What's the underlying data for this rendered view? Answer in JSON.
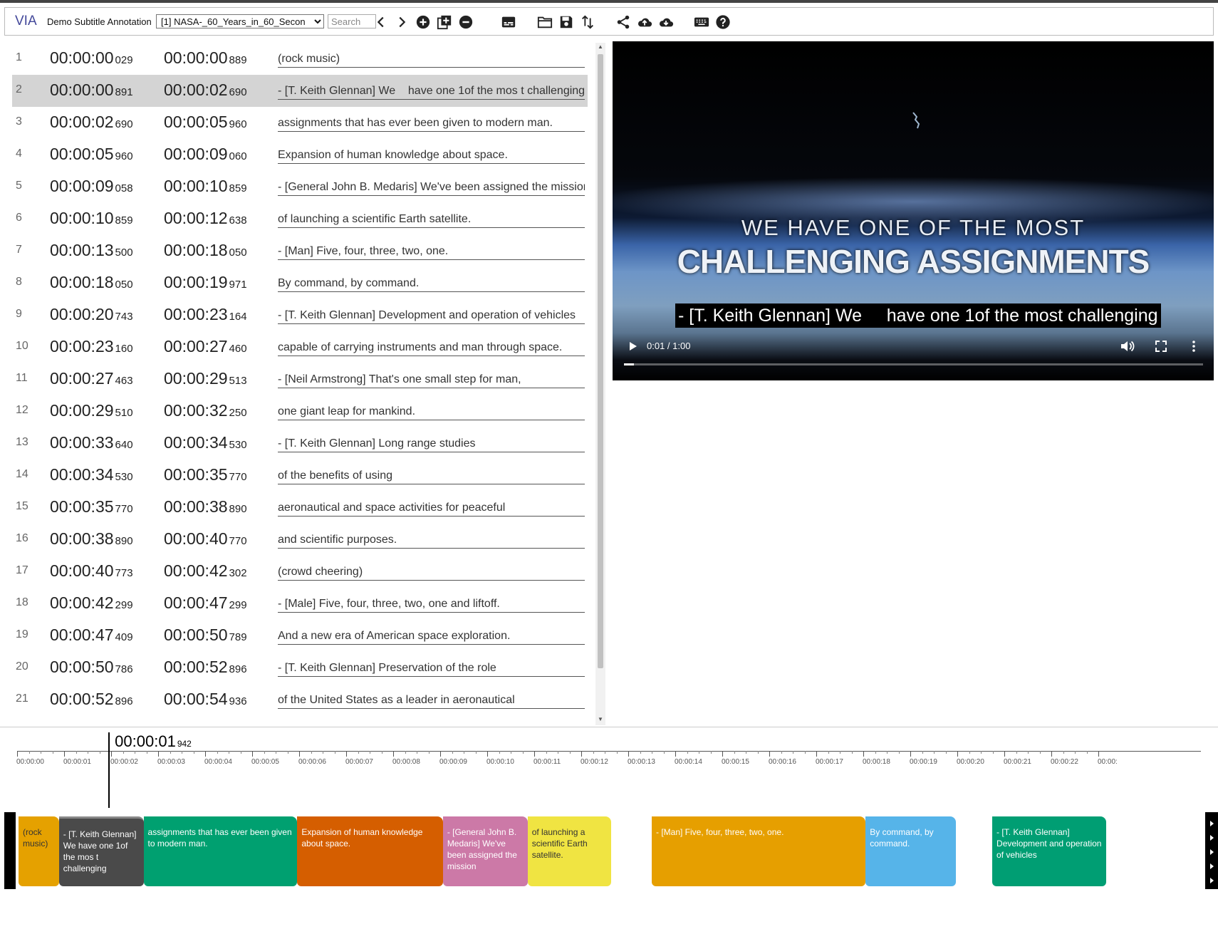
{
  "app": {
    "logo": "VIA",
    "project_name": "Demo Subtitle Annotation",
    "file_selected": "[1] NASA-_60_Years_in_60_Secon",
    "search_placeholder": "Search"
  },
  "subtitles": [
    {
      "idx": "1",
      "start": "00:00:00",
      "start_ms": "029",
      "end": "00:00:00",
      "end_ms": "889",
      "text": "(rock music)"
    },
    {
      "idx": "2",
      "start": "00:00:00",
      "start_ms": "891",
      "end": "00:00:02",
      "end_ms": "690",
      "text": "- [T. Keith Glennan] We    have one 1of the mos t challenging"
    },
    {
      "idx": "3",
      "start": "00:00:02",
      "start_ms": "690",
      "end": "00:00:05",
      "end_ms": "960",
      "text": "assignments that has ever been given to modern man."
    },
    {
      "idx": "4",
      "start": "00:00:05",
      "start_ms": "960",
      "end": "00:00:09",
      "end_ms": "060",
      "text": "Expansion of human knowledge about space."
    },
    {
      "idx": "5",
      "start": "00:00:09",
      "start_ms": "058",
      "end": "00:00:10",
      "end_ms": "859",
      "text": "- [General John B. Medaris] We've been assigned the mission"
    },
    {
      "idx": "6",
      "start": "00:00:10",
      "start_ms": "859",
      "end": "00:00:12",
      "end_ms": "638",
      "text": "of launching a scientific Earth satellite."
    },
    {
      "idx": "7",
      "start": "00:00:13",
      "start_ms": "500",
      "end": "00:00:18",
      "end_ms": "050",
      "text": "- [Man] Five, four, three, two, one."
    },
    {
      "idx": "8",
      "start": "00:00:18",
      "start_ms": "050",
      "end": "00:00:19",
      "end_ms": "971",
      "text": "By command, by command."
    },
    {
      "idx": "9",
      "start": "00:00:20",
      "start_ms": "743",
      "end": "00:00:23",
      "end_ms": "164",
      "text": "- [T. Keith Glennan] Development and operation of vehicles"
    },
    {
      "idx": "10",
      "start": "00:00:23",
      "start_ms": "160",
      "end": "00:00:27",
      "end_ms": "460",
      "text": "capable of carrying instruments and man through space."
    },
    {
      "idx": "11",
      "start": "00:00:27",
      "start_ms": "463",
      "end": "00:00:29",
      "end_ms": "513",
      "text": "- [Neil Armstrong] That's one small step for man,"
    },
    {
      "idx": "12",
      "start": "00:00:29",
      "start_ms": "510",
      "end": "00:00:32",
      "end_ms": "250",
      "text": "one giant leap for mankind."
    },
    {
      "idx": "13",
      "start": "00:00:33",
      "start_ms": "640",
      "end": "00:00:34",
      "end_ms": "530",
      "text": "- [T. Keith Glennan] Long range studies"
    },
    {
      "idx": "14",
      "start": "00:00:34",
      "start_ms": "530",
      "end": "00:00:35",
      "end_ms": "770",
      "text": "of the benefits of using"
    },
    {
      "idx": "15",
      "start": "00:00:35",
      "start_ms": "770",
      "end": "00:00:38",
      "end_ms": "890",
      "text": "aeronautical and space activities for peaceful"
    },
    {
      "idx": "16",
      "start": "00:00:38",
      "start_ms": "890",
      "end": "00:00:40",
      "end_ms": "770",
      "text": "and scientific purposes."
    },
    {
      "idx": "17",
      "start": "00:00:40",
      "start_ms": "773",
      "end": "00:00:42",
      "end_ms": "302",
      "text": "(crowd cheering)"
    },
    {
      "idx": "18",
      "start": "00:00:42",
      "start_ms": "299",
      "end": "00:00:47",
      "end_ms": "299",
      "text": "- [Male] Five, four, three, two, one and liftoff."
    },
    {
      "idx": "19",
      "start": "00:00:47",
      "start_ms": "409",
      "end": "00:00:50",
      "end_ms": "789",
      "text": "And a new era of American space exploration."
    },
    {
      "idx": "20",
      "start": "00:00:50",
      "start_ms": "786",
      "end": "00:00:52",
      "end_ms": "896",
      "text": "- [T. Keith Glennan] Preservation of the role"
    },
    {
      "idx": "21",
      "start": "00:00:52",
      "start_ms": "896",
      "end": "00:00:54",
      "end_ms": "936",
      "text": "of the United States as a leader in aeronautical"
    }
  ],
  "selected_row": 1,
  "video": {
    "title_line1": "WE HAVE ONE OF THE MOST",
    "title_line2": "CHALLENGING ASSIGNMENTS",
    "caption": "- [T. Keith Glennan] We     have one 1of the most challenging",
    "time": "0:01 / 1:00",
    "progress": 0.0167
  },
  "timeline": {
    "current": "00:00:01",
    "current_ms": "942",
    "labels": [
      "00:00:00",
      "00:00:01",
      "00:00:02",
      "00:00:03",
      "00:00:04",
      "00:00:05",
      "00:00:06",
      "00:00:07",
      "00:00:08",
      "00:00:09",
      "00:00:10",
      "00:00:11",
      "00:00:12",
      "00:00:13",
      "00:00:14",
      "00:00:15",
      "00:00:16",
      "00:00:17",
      "00:00:18",
      "00:00:19",
      "00:00:20",
      "00:00:21",
      "00:00:22",
      "00:00:"
    ],
    "segments": [
      {
        "text": "(rock music)",
        "color": "#e5a100",
        "start": 0.029,
        "end": 0.889,
        "tone": "light"
      },
      {
        "text": "- [T. Keith Glennan] We    have one 1of the mos t challenging",
        "color": "#4a4a4a",
        "start": 0.891,
        "end": 2.69,
        "tone": "dark"
      },
      {
        "text": "assignments that has ever been given to modern man.",
        "color": "#00a070",
        "start": 2.69,
        "end": 5.96,
        "tone": "dark"
      },
      {
        "text": "Expansion of human knowledge about space.",
        "color": "#d55e00",
        "start": 5.96,
        "end": 9.06,
        "tone": "dark"
      },
      {
        "text": "- [General John B. Medaris] We've been assigned the mission",
        "color": "#cc79a7",
        "start": 9.058,
        "end": 10.859,
        "tone": "dark"
      },
      {
        "text": "of launching a scientific Earth satellite.",
        "color": "#f0e442",
        "start": 10.859,
        "end": 12.638,
        "tone": "light"
      },
      {
        "text": "- [Man] Five, four, three, two, one.",
        "color": "#e69f00",
        "start": 13.5,
        "end": 18.05,
        "tone": "dark"
      },
      {
        "text": "By command, by command.",
        "color": "#56b4e9",
        "start": 18.05,
        "end": 19.971,
        "tone": "dark"
      },
      {
        "text": "- [T. Keith Glennan] Development and operation of vehicles",
        "color": "#009e73",
        "start": 20.743,
        "end": 23.164,
        "tone": "dark"
      }
    ]
  }
}
